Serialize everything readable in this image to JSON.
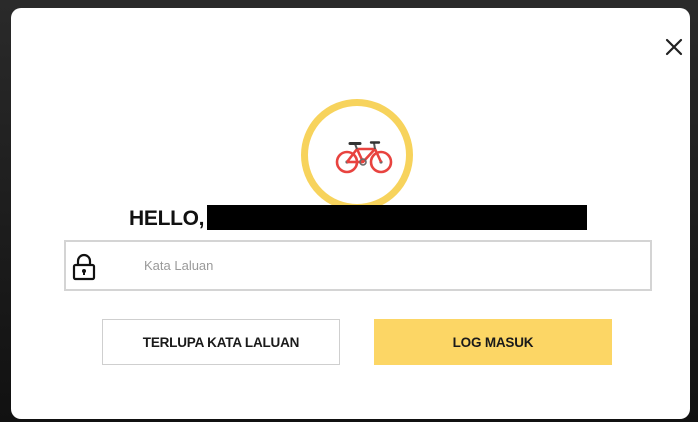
{
  "modal": {
    "close_label": "×",
    "greeting": "HELLO,",
    "username_redacted": true,
    "avatar_icon": "bicycle-icon",
    "password": {
      "placeholder": "Kata Laluan",
      "value": "",
      "icon": "lock-icon"
    },
    "buttons": {
      "forgot_label": "TERLUPA KATA LALUAN",
      "login_label": "LOG MASUK"
    },
    "colors": {
      "accent": "#fcd665",
      "ring": "#f7d35c",
      "bike": "#e8433f"
    }
  }
}
